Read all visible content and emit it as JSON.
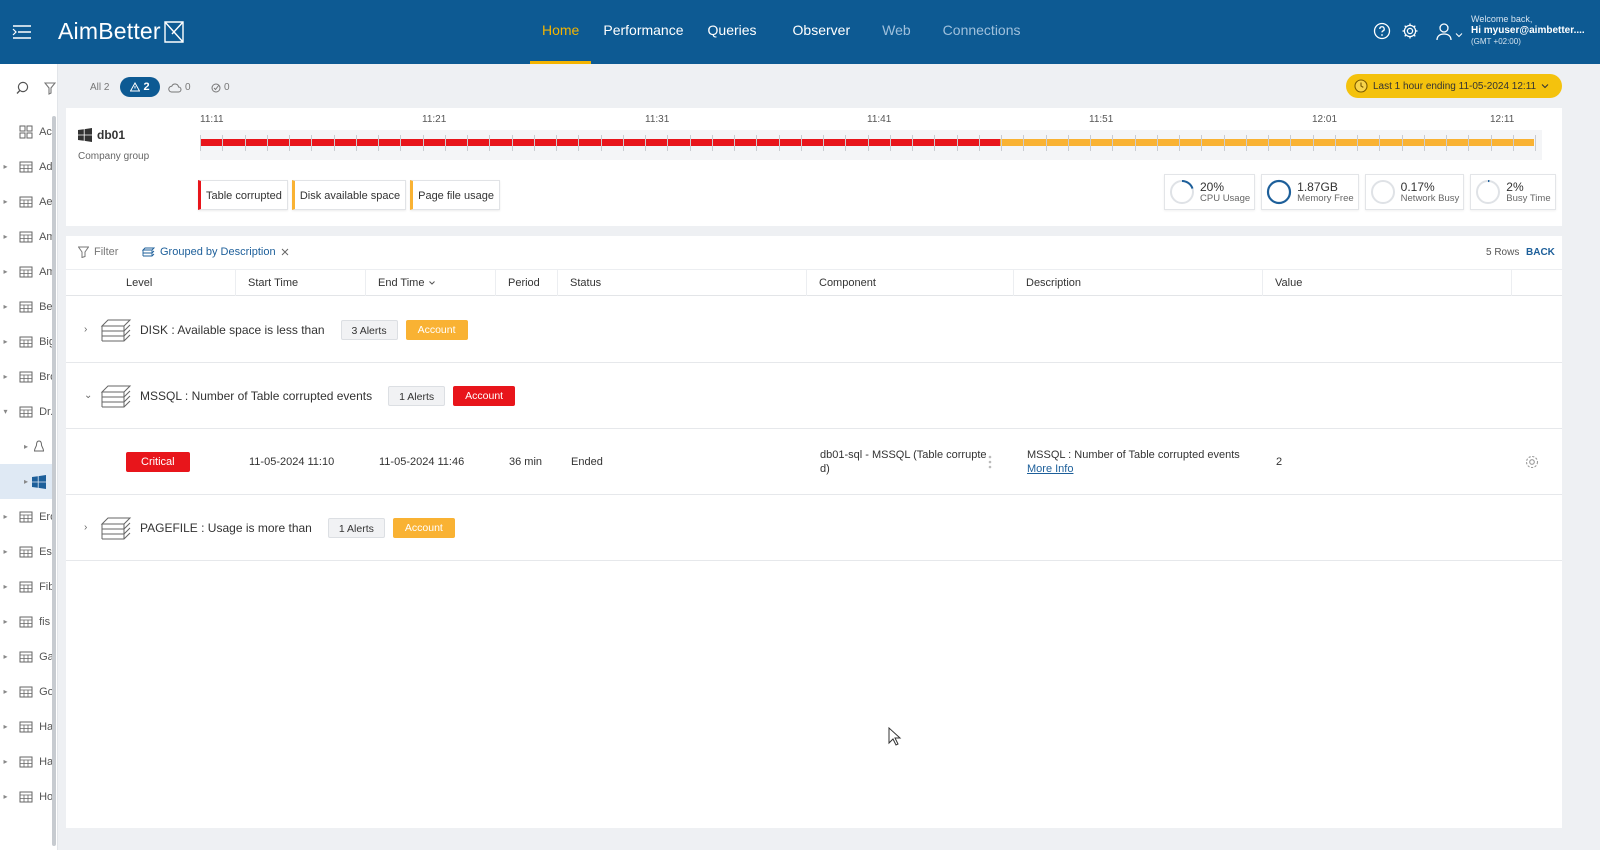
{
  "app": {
    "logo_text": "AimBetter"
  },
  "nav": {
    "items": [
      {
        "label": "Home",
        "state": "active"
      },
      {
        "label": "Performance",
        "state": "normal"
      },
      {
        "label": "Queries",
        "state": "normal"
      },
      {
        "label": "Observer",
        "state": "normal"
      },
      {
        "label": "Web",
        "state": "dim"
      },
      {
        "label": "Connections",
        "state": "dim"
      }
    ]
  },
  "user": {
    "welcome": "Welcome back,",
    "greeting": "Hi myuser@aimbetter....",
    "timezone": "(GMT +02:00)"
  },
  "sidebar": {
    "items": [
      {
        "label": "Ac",
        "icon": "grid-icon"
      },
      {
        "label": "Ad",
        "icon": "table-icon"
      },
      {
        "label": "Ae",
        "icon": "table-icon"
      },
      {
        "label": "Am",
        "icon": "table-icon"
      },
      {
        "label": "Am",
        "icon": "table-icon"
      },
      {
        "label": "Be",
        "icon": "table-icon"
      },
      {
        "label": "Big",
        "icon": "table-icon"
      },
      {
        "label": "Bro",
        "icon": "table-icon"
      },
      {
        "label": "Dr.",
        "icon": "table-icon"
      },
      {
        "label": "",
        "icon": "linux-icon"
      },
      {
        "label": "",
        "icon": "windows-icon"
      },
      {
        "label": "Ero",
        "icon": "table-icon"
      },
      {
        "label": "Esp",
        "icon": "table-icon"
      },
      {
        "label": "Fib",
        "icon": "table-icon"
      },
      {
        "label": "fis",
        "icon": "table-icon"
      },
      {
        "label": "Ga",
        "icon": "table-icon"
      },
      {
        "label": "Go",
        "icon": "table-icon"
      },
      {
        "label": "Ha",
        "icon": "table-icon"
      },
      {
        "label": "Ha",
        "icon": "table-icon"
      },
      {
        "label": "Ho",
        "icon": "table-icon"
      }
    ]
  },
  "strip": {
    "all_label": "All 2",
    "alert_count": "2",
    "cloud_count": "0",
    "check_count": "0",
    "time_range": "Last 1 hour ending  11-05-2024 12:11"
  },
  "host": {
    "name": "db01",
    "group": "Company group",
    "timeline_labels": [
      "11:11",
      "11:21",
      "11:31",
      "11:41",
      "11:51",
      "12:01",
      "12:11"
    ],
    "chips": [
      {
        "label": "Table corrupted",
        "severity": "red"
      },
      {
        "label": "Disk available space",
        "severity": "orange"
      },
      {
        "label": "Page file usage",
        "severity": "orange"
      }
    ],
    "metrics": [
      {
        "value": "20%",
        "label": "CPU Usage",
        "ring": 0.2
      },
      {
        "value": "1.87GB",
        "label": "Memory Free",
        "ring": 1.0
      },
      {
        "value": "0.17%",
        "label": "Network Busy",
        "ring": 0.0
      },
      {
        "value": "2%",
        "label": "Busy Time",
        "ring": 0.02
      }
    ]
  },
  "grid": {
    "filter_label": "Filter",
    "group_label": "Grouped by Description",
    "rows_label": "5 Rows",
    "back_label": "BACK",
    "columns": [
      "Level",
      "Start Time",
      "End Time",
      "Period",
      "Status",
      "Component",
      "Description",
      "Value"
    ],
    "groups": [
      {
        "title": "DISK : Available space is less than",
        "count": "3 Alerts",
        "account": "Account",
        "color": "orange",
        "expanded": false
      },
      {
        "title": "MSSQL : Number of Table corrupted events",
        "count": "1 Alerts",
        "account": "Account",
        "color": "red",
        "expanded": true
      },
      {
        "title": "PAGEFILE : Usage is more than",
        "count": "1 Alerts",
        "account": "Account",
        "color": "orange",
        "expanded": false
      }
    ],
    "detail": {
      "level": "Critical",
      "start": "11-05-2024 11:10",
      "end": "11-05-2024 11:46",
      "period": "36 min",
      "status": "Ended",
      "component_line1": "db01-sql - MSSQL (Table corrupte",
      "component_line2": "d)",
      "description": "MSSQL : Number of Table corrupted events",
      "more_info": "More Info",
      "value": "2"
    }
  }
}
